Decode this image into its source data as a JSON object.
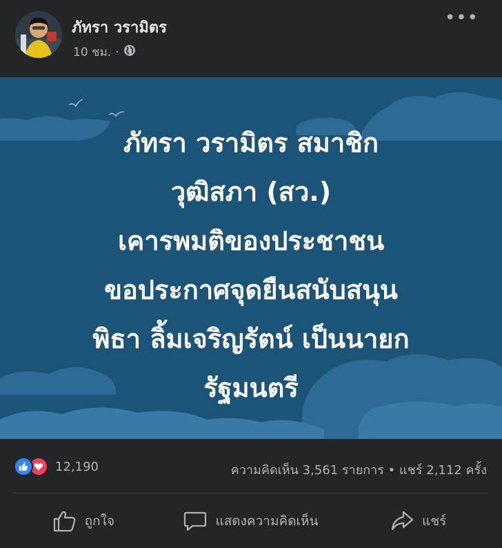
{
  "post": {
    "author": "ภัทรา วรามิตร",
    "time": "10 ชม.",
    "separator": "·",
    "privacy_icon": "globe-icon",
    "more_icon": "more-horizontal-icon",
    "more_label": "•••"
  },
  "banner": {
    "lines": [
      "ภัทรา  วรามิตร สมาชิก",
      "วุฒิสภา (สว.)",
      "เคารพมติของประชาชน",
      "ขอประกาศจุดยืนสนับสนุน",
      "พิธา ลิ้มเจริญรัตน์ เป็นนายก",
      "รัฐมนตรี"
    ],
    "background_color": "#1c5478",
    "text_color": "#ffffff"
  },
  "stats": {
    "reactions": [
      "like-reaction-icon",
      "love-reaction-icon"
    ],
    "reaction_count": "12,190",
    "comments": "ความคิดเห็น 3,561 รายการ",
    "dot": "•",
    "shares": "แชร์ 2,112 ครั้ง"
  },
  "actions": {
    "like_label": "ถูกใจ",
    "comment_label": "แสดงความคิดเห็น",
    "share_label": "แชร์"
  },
  "colors": {
    "background": "#242526",
    "secondary_text": "#b0b3b8",
    "like_blue": "#2d88ff",
    "love_red": "#f33e58"
  }
}
